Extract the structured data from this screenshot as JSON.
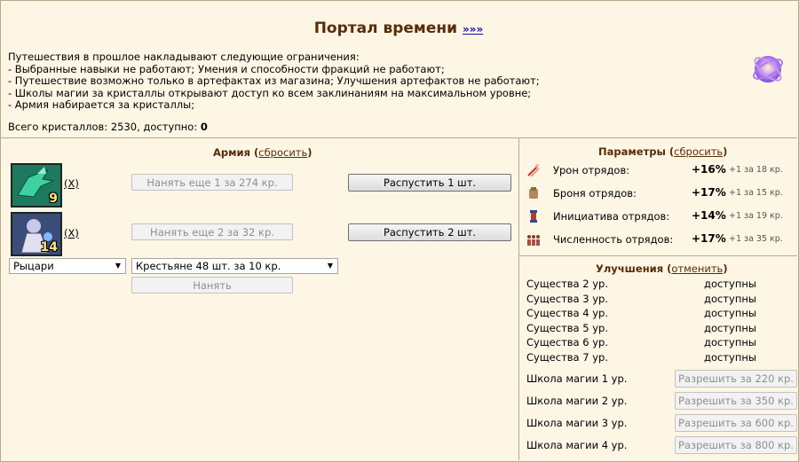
{
  "header": {
    "title": "Портал времени",
    "title_link": "»»»",
    "restrictions_intro": "Путешествия в прошлое накладывают следующие ограничения:",
    "restrictions": [
      "- Выбранные навыки не работают; Умения и способности фракций не работают;",
      "- Путешествие возможно только в артефактах из магазина; Улучшения артефактов не работают;",
      "- Школы магии за кристаллы открывают доступ ко всем заклинаниям на максимальном уровне;",
      "- Армия набирается за кристаллы;"
    ],
    "crystals_prefix": "Всего кристаллов: 2530, доступно: ",
    "crystals_available": "0",
    "orb_icon": "portal-orb-icon"
  },
  "army": {
    "title": "Армия",
    "reset_label": "сбросить",
    "units": [
      {
        "icon": "dragon-unit-icon",
        "count": "9",
        "remove_label": "(X)",
        "hire_label": "Нанять еще 1 за 274 кр.",
        "dismiss_label": "Распустить 1 шт."
      },
      {
        "icon": "mage-unit-icon",
        "count": "14",
        "remove_label": "(X)",
        "hire_label": "Нанять еще 2 за 32 кр.",
        "dismiss_label": "Распустить 2 шт."
      }
    ],
    "faction_select": "Рыцари",
    "unit_select": "Крестьяне 48 шт. за 10 кр.",
    "hire_button": "Нанять"
  },
  "params": {
    "title": "Параметры",
    "reset_label": "сбросить",
    "rows": [
      {
        "icon": "damage-icon",
        "label": "Урон отрядов:",
        "value": "+16%",
        "note": "+1 за 18 кр."
      },
      {
        "icon": "armor-icon",
        "label": "Броня отрядов:",
        "value": "+17%",
        "note": "+1 за 15 кр."
      },
      {
        "icon": "initiative-icon",
        "label": "Инициатива отрядов:",
        "value": "+14%",
        "note": "+1 за 19 кр."
      },
      {
        "icon": "troop-size-icon",
        "label": "Численность отрядов:",
        "value": "+17%",
        "note": "+1 за 35 кр."
      }
    ]
  },
  "upgrades": {
    "title": "Улучшения",
    "cancel_label": "отменить",
    "creatures": [
      {
        "label": "Существа 2 ур.",
        "status": "доступны"
      },
      {
        "label": "Существа 3 ур.",
        "status": "доступны"
      },
      {
        "label": "Существа 4 ур.",
        "status": "доступны"
      },
      {
        "label": "Существа 5 ур.",
        "status": "доступны"
      },
      {
        "label": "Существа 6 ур.",
        "status": "доступны"
      },
      {
        "label": "Существа 7 ур.",
        "status": "доступны"
      }
    ],
    "magic": [
      {
        "label": "Школа магии 1 ур.",
        "button": "Разрешить за 220 кр."
      },
      {
        "label": "Школа магии 2 ур.",
        "button": "Разрешить за 350 кр."
      },
      {
        "label": "Школа магии 3 ур.",
        "button": "Разрешить за 600 кр."
      },
      {
        "label": "Школа магии 4 ур.",
        "button": "Разрешить за 800 кр."
      }
    ]
  }
}
